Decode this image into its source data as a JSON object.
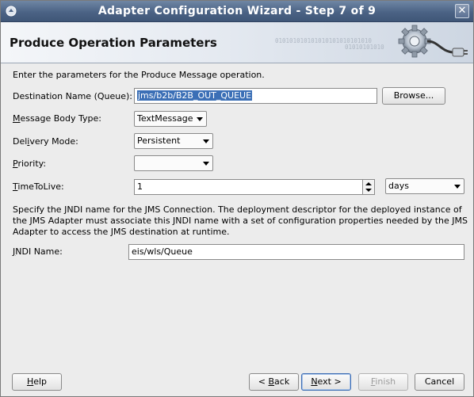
{
  "window": {
    "title": "Adapter Configuration Wizard - Step 7 of 9",
    "close_glyph": "✕"
  },
  "banner": {
    "title": "Produce Operation Parameters",
    "binary_text_line1": "010101010101010101010101010",
    "binary_text_line2": "01010101010"
  },
  "content": {
    "intro": "Enter the parameters for the Produce Message operation.",
    "destination": {
      "label": "Destination Name (Queue):",
      "value": "jms/b2b/B2B_OUT_QUEUE",
      "browse_label": "Browse..."
    },
    "message_body_type": {
      "label_pre": "",
      "label_mnemonic": "M",
      "label_post": "essage Body Type:",
      "value": "TextMessage"
    },
    "delivery_mode": {
      "label_pre": "Del",
      "label_mnemonic": "i",
      "label_post": "very Mode:",
      "value": "Persistent"
    },
    "priority": {
      "label_pre": "",
      "label_mnemonic": "P",
      "label_post": "riority:",
      "value": ""
    },
    "time_to_live": {
      "label_pre": "",
      "label_mnemonic": "T",
      "label_post": "imeToLive:",
      "value": "1",
      "unit": "days"
    },
    "jndi_description": "Specify the JNDI name for the JMS Connection.  The deployment descriptor for the deployed instance of the JMS Adapter must associate this JNDI name with a set of configuration properties needed by the JMS Adapter to access the JMS destination at runtime.",
    "jndi": {
      "label_pre": "",
      "label_mnemonic": "J",
      "label_post": "NDI Name:",
      "value": "eis/wls/Queue"
    }
  },
  "footer": {
    "help_mnemonic": "H",
    "help_rest": "elp",
    "back_pre": "< ",
    "back_mnemonic": "B",
    "back_rest": "ack",
    "next_mnemonic": "N",
    "next_rest": "ext >",
    "finish_mnemonic": "F",
    "finish_rest": "inish",
    "cancel_label": "Cancel"
  }
}
